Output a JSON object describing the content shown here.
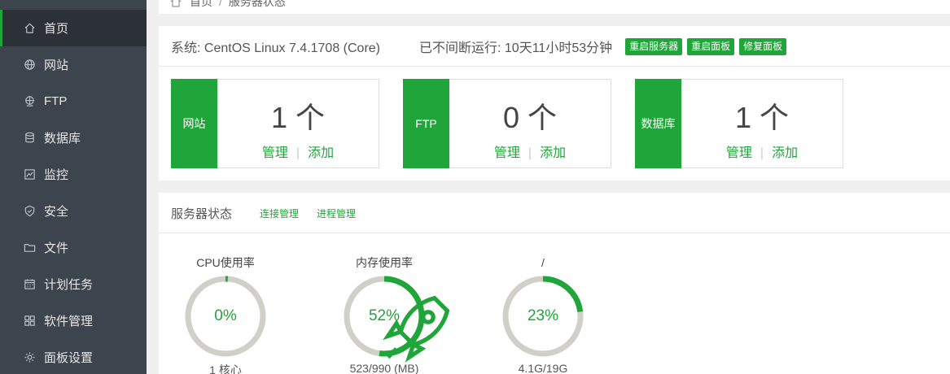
{
  "breadcrumb": {
    "home": "首页",
    "separator": "/",
    "current": "服务器状态"
  },
  "sidebar": {
    "items": [
      {
        "label": "首页",
        "icon": "home-icon",
        "active": true
      },
      {
        "label": "网站",
        "icon": "globe-icon"
      },
      {
        "label": "FTP",
        "icon": "ftp-icon"
      },
      {
        "label": "数据库",
        "icon": "database-icon"
      },
      {
        "label": "监控",
        "icon": "monitor-icon"
      },
      {
        "label": "安全",
        "icon": "shield-icon"
      },
      {
        "label": "文件",
        "icon": "folder-icon"
      },
      {
        "label": "计划任务",
        "icon": "calendar-icon"
      },
      {
        "label": "软件管理",
        "icon": "grid-icon"
      },
      {
        "label": "面板设置",
        "icon": "gear-icon"
      }
    ]
  },
  "system": {
    "os": "系统: CentOS Linux 7.4.1708 (Core)",
    "uptime": "已不间断运行: 10天11小时53分钟",
    "buttons": [
      "重启服务器",
      "重启面板",
      "修复面板"
    ]
  },
  "stats": [
    {
      "tag": "网站",
      "count": "1 个",
      "manage": "管理",
      "add": "添加"
    },
    {
      "tag": "FTP",
      "count": "0 个",
      "manage": "管理",
      "add": "添加"
    },
    {
      "tag": "数据库",
      "count": "1 个",
      "manage": "管理",
      "add": "添加"
    }
  ],
  "status": {
    "title": "服务器状态",
    "links": [
      "连接管理",
      "进程管理"
    ],
    "gauges": [
      {
        "title": "CPU使用率",
        "percent_text": "0%",
        "value": 0.01,
        "sub": "1 核心"
      },
      {
        "title": "内存使用率",
        "percent_text": "52%",
        "value": 0.52,
        "sub": "523/990 (MB)",
        "icon": "rocket-icon"
      },
      {
        "title": "/",
        "percent_text": "23%",
        "value": 0.23,
        "sub": "4.1G/19G"
      }
    ]
  },
  "colors": {
    "accent": "#20a53a",
    "sidebar_bg": "#3c444d",
    "ring_track": "#d0d0c8"
  }
}
